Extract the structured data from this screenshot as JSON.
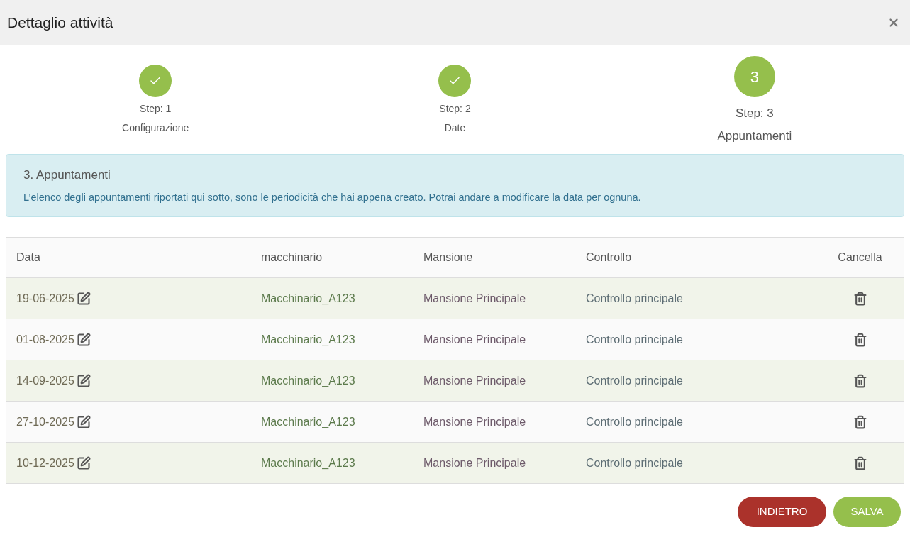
{
  "window": {
    "title": "Dettaglio attività"
  },
  "steps": [
    {
      "kind": "done",
      "step": "Step: 1",
      "label": "Configurazione"
    },
    {
      "kind": "done",
      "step": "Step: 2",
      "label": "Date"
    },
    {
      "kind": "current",
      "number": "3",
      "step": "Step: 3",
      "label": "Appuntamenti"
    }
  ],
  "alert": {
    "title": "3. Appuntamenti",
    "text": "L’elenco degli appuntamenti riportati qui sotto, sono le periodicità che hai appena creato. Potrai andare a modificare la data per ognuna."
  },
  "table": {
    "columns": [
      "Data",
      "macchinario",
      "Mansione",
      "Controllo",
      "Cancella"
    ],
    "rows": [
      {
        "date": "19-06-2025",
        "machine": "Macchinario_A123",
        "task": "Mansione Principale",
        "check": "Controllo principale"
      },
      {
        "date": "01-08-2025",
        "machine": "Macchinario_A123",
        "task": "Mansione Principale",
        "check": "Controllo principale"
      },
      {
        "date": "14-09-2025",
        "machine": "Macchinario_A123",
        "task": "Mansione Principale",
        "check": "Controllo principale"
      },
      {
        "date": "27-10-2025",
        "machine": "Macchinario_A123",
        "task": "Mansione Principale",
        "check": "Controllo principale"
      },
      {
        "date": "10-12-2025",
        "machine": "Macchinario_A123",
        "task": "Mansione Principale",
        "check": "Controllo principale"
      }
    ]
  },
  "buttons": [
    {
      "kind": "back",
      "label": "INDIETRO"
    },
    {
      "kind": "save",
      "label": "SALVA"
    }
  ]
}
